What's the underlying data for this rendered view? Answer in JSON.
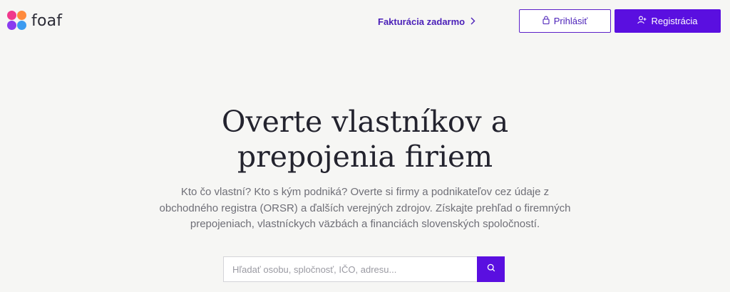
{
  "brand": {
    "name": "foaf",
    "colors": {
      "accent": "#5a0fe0",
      "accent_text": "#4a1fb8",
      "petal_pink": "#f0398c",
      "petal_orange": "#ff8a3c",
      "petal_purple": "#8a3cf0",
      "petal_blue": "#3c9bf0"
    }
  },
  "header": {
    "promo_label": "Fakturácia zadarmo",
    "promo_icon": "chevron-right-icon",
    "login_label": "Prihlásiť",
    "login_icon": "lock-icon",
    "register_label": "Registrácia",
    "register_icon": "add-user-icon"
  },
  "hero": {
    "title_line1": "Overte vlastníkov a",
    "title_line2": "prepojenia firiem",
    "subtitle": "Kto čo vlastní? Kto s kým podniká? Overte si firmy a podnikateľov cez údaje z obchodného registra (ORSR) a ďalších verejných zdrojov. Získajte prehľad o firemných prepojeniach, vlastníckych väzbách a financiách slovenských spoločností."
  },
  "search": {
    "placeholder": "Hľadať osobu, spločnosť, IČO, adresu...",
    "value": "",
    "button_icon": "search-icon"
  }
}
